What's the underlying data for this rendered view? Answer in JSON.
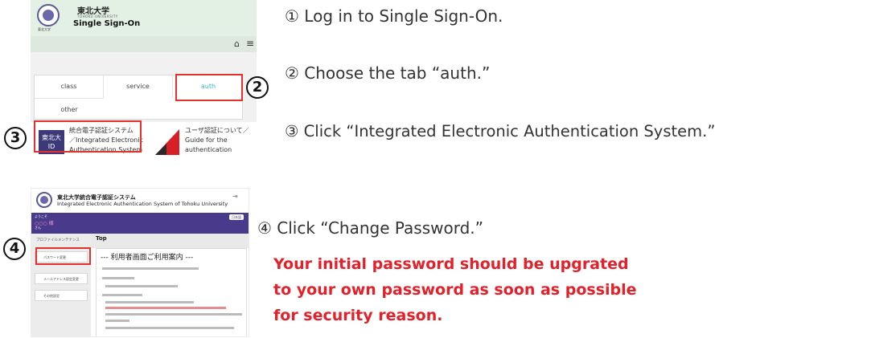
{
  "screenshot1": {
    "header": {
      "logo_caption": "東北大学",
      "name_ja": "東北大学",
      "name_en_small": "TOHOKU UNIVERSITY",
      "name_en": "Single Sign-On"
    },
    "toolbar": {
      "home_icon": "home-icon",
      "menu_icon": "hamburger-menu-icon"
    },
    "tabs": [
      {
        "label": "class"
      },
      {
        "label": "service"
      },
      {
        "label": "auth",
        "selected": true
      },
      {
        "label": "other"
      }
    ],
    "tiles": [
      {
        "badge_line1": "東北大",
        "badge_line2": "ID",
        "label_line1": "統合電子認証システム",
        "label_line2": "／Integrated Electronic",
        "label_line3": "Authentication System"
      },
      {
        "label_line1": "ユーザ認証について／",
        "label_line2": "Guide for the",
        "label_line3": "authentication"
      }
    ]
  },
  "screenshot2": {
    "title_ja": "東北大学統合電子認証システム",
    "title_en": "Integrated Electronic Authentication System of Tohoku University",
    "bar": {
      "line1": "ようこそ",
      "line2": "○○○ 様",
      "line3": "さん",
      "button": "日本語"
    },
    "sidebar": {
      "heading": "プロファイルメンテナンス",
      "items": [
        {
          "label": "パスワード変更"
        },
        {
          "label": "メールアドレス設定変更"
        },
        {
          "label": "その他設定"
        }
      ]
    },
    "tab_label": "Top",
    "content_title": "--- 利用者画面ご利用案内 ---"
  },
  "markers": {
    "m2": "2",
    "m3": "3",
    "m4": "4"
  },
  "instructions": {
    "step1": "① Log in to Single Sign-On.",
    "step2": "② Choose the tab “auth.”",
    "step3": "③ Click “Integrated Electronic Authentication System.”",
    "step4": "④ Click “Change Password.”"
  },
  "warning": {
    "line1": "Your initial password should be upgrated",
    "line2": "to your own password as soon as possible",
    "line3": "for security reason."
  },
  "colors": {
    "highlight_red": "#e4322b",
    "warning_red": "#e4212a",
    "header_green": "#e2f1e3",
    "auth_tab": "#3db5c5",
    "purple_bar": "#4a3a8c",
    "id_badge": "#3d3979"
  }
}
